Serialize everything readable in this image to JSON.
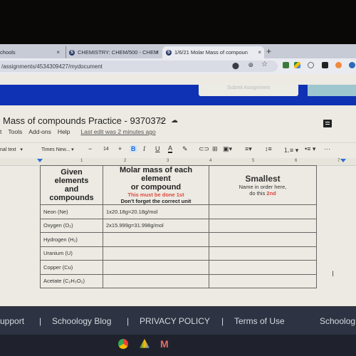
{
  "browser": {
    "tabs": [
      {
        "label": "chools",
        "label_full": "Schoology",
        "active": false
      },
      {
        "label": "CHEMISTRY: CHEM/500 - CHEM",
        "active": false
      },
      {
        "label": "1/6/21 Molar Mass of compoun",
        "active": true
      }
    ],
    "url": "/assignments/4534309427/mydocument",
    "tab_close": "×",
    "new_tab": "+"
  },
  "schoology": {
    "submit_button": "Submit Assignment"
  },
  "doc": {
    "title": "Mass of compounds Practice - 9370372",
    "menu": [
      "t",
      "Tools",
      "Add-ons",
      "Help"
    ],
    "last_edit": "Last edit was 2 minutes ago",
    "toolbar": {
      "style": "nal text",
      "font": "Times New...",
      "font_size": "14",
      "minus": "−",
      "plus": "+",
      "bold": "B",
      "italic": "I",
      "underline": "U",
      "text_color": "A",
      "more": "···"
    },
    "ruler": [
      "1",
      "2",
      "3",
      "4",
      "5",
      "6",
      "7"
    ],
    "table": {
      "headers": {
        "col1": [
          "Given elements",
          "and",
          "compounds"
        ],
        "col2_title": [
          "Molar mass of each element",
          "or compound"
        ],
        "col2_red": "This must be done 1st",
        "col2_note": "Don't forget the correct unit",
        "col3_title": "Smallest",
        "col3_note_a": "Name in order here,",
        "col3_note_b": "do this ",
        "col3_red": "2nd"
      },
      "rows": [
        {
          "name": "Neon (Ne)",
          "mass": "1x20.18g=20.18g/mol",
          "order": ""
        },
        {
          "name": "Oxygen (O₂)",
          "mass": "2x15.999g=31.998g/mol",
          "order": ""
        },
        {
          "name": "Hydrogen (H₂)",
          "mass": "",
          "order": ""
        },
        {
          "name": "Uranium (U)",
          "mass": "",
          "order": ""
        },
        {
          "name": "Copper (Cu)",
          "mass": "",
          "order": ""
        },
        {
          "name": "Acetate (C₂H₃O₂)",
          "mass": "",
          "order": ""
        }
      ]
    }
  },
  "footer": {
    "links": [
      "upport",
      "|",
      "Schoology Blog",
      "|",
      "PRIVACY POLICY",
      "|",
      "Terms of Use",
      "Schoolog"
    ]
  },
  "colors": {
    "accent_blue": "#0f31b4",
    "red_note": "#e0473c"
  }
}
